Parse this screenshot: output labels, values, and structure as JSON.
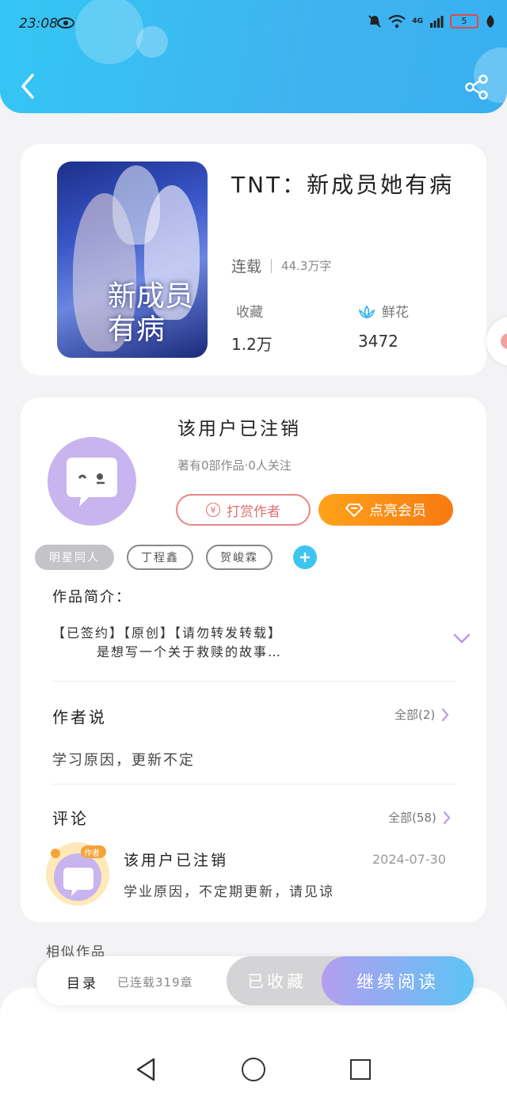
{
  "status_bar": {
    "time": "23:08",
    "battery": "5",
    "network": "4G"
  },
  "book": {
    "title": "TNT：新成员她有病",
    "status": "连载",
    "word_count": "44.3万字",
    "collect_label": "收藏",
    "collect_count": "1.2万",
    "flower_label": "鲜花",
    "flower_count": "3472",
    "cover_text": "新成员有病"
  },
  "author": {
    "name": "该用户已注销",
    "summary": "著有0部作品·0人关注",
    "tip_label": "打赏作者",
    "tip_icon": "¥",
    "vip_label": "点亮会员"
  },
  "tags": [
    "明星同人",
    "丁程鑫",
    "贺峻霖"
  ],
  "intro": {
    "label": "作品简介：",
    "line1": "【已签约】【原创】【请勿转发转载】",
    "line2": "是想写一个关于救赎的故事…"
  },
  "author_says": {
    "title": "作者说",
    "all_label": "全部(2)",
    "text": "学习原因，更新不定"
  },
  "comments": {
    "title": "评论",
    "all_label": "全部(58)",
    "items": [
      {
        "name": "该用户已注销",
        "badge": "作者",
        "time": "2024-07-30",
        "text": "学业原因，不定期更新，请见谅"
      }
    ]
  },
  "similar_label": "相似作品",
  "action_bar": {
    "toc_label": "目录",
    "toc_count": "已连载319章",
    "collected_label": "已收藏",
    "continue_label": "继续阅读"
  },
  "colors": {
    "header_start": "#34c6f4",
    "header_end": "#38b0f0",
    "vip_orange": "#f77a12",
    "tip_red": "#e07070",
    "accent_purple": "#b49df0"
  }
}
